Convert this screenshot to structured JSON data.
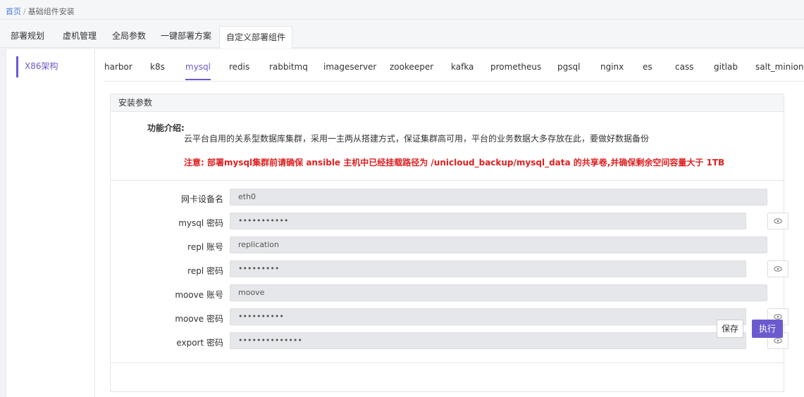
{
  "breadcrumb": {
    "home": "首页",
    "separator": "/",
    "current": "基础组件安装"
  },
  "top_tabs": [
    {
      "label": "部署规划",
      "active": false
    },
    {
      "label": "虚机管理",
      "active": false
    },
    {
      "label": "全局参数",
      "active": false
    },
    {
      "label": "一键部署方案",
      "active": false
    },
    {
      "label": "自定义部署组件",
      "active": true
    }
  ],
  "sidebar": {
    "items": [
      {
        "label": "X86架构",
        "active": true
      }
    ]
  },
  "sub_tabs": [
    {
      "label": "harbor"
    },
    {
      "label": "k8s"
    },
    {
      "label": "mysql",
      "active": true
    },
    {
      "label": "redis"
    },
    {
      "label": "rabbitmq"
    },
    {
      "label": "imageserver"
    },
    {
      "label": "zookeeper"
    },
    {
      "label": "kafka"
    },
    {
      "label": "prometheus"
    },
    {
      "label": "pgsql"
    },
    {
      "label": "nginx"
    },
    {
      "label": "es"
    },
    {
      "label": "cass"
    },
    {
      "label": "gitlab"
    },
    {
      "label": "salt_minion"
    }
  ],
  "panel": {
    "title": "安装参数",
    "intro_label": "功能介绍:",
    "intro_text": "云平台自用的关系型数据库集群，采用一主两从搭建方式，保证集群高可用，平台的业务数据大多存放在此，要做好数据备份",
    "warning": "注意: 部署mysql集群前请确保 ansible 主机中已经挂载路径为 /unicloud_backup/mysql_data 的共享卷,并确保剩余空间容量大于 1TB",
    "fields": [
      {
        "label": "网卡设备名",
        "value": "eth0",
        "password": false
      },
      {
        "label": "mysql 密码",
        "value": "•••••••••••",
        "password": true
      },
      {
        "label": "repl 账号",
        "value": "replication",
        "password": false
      },
      {
        "label": "repl 密码",
        "value": "•••••••••",
        "password": true
      },
      {
        "label": "moove 账号",
        "value": "moove",
        "password": false
      },
      {
        "label": "moove 密码",
        "value": "••••••••••",
        "password": true
      },
      {
        "label": "export 密码",
        "value": "••••••••••••••",
        "password": true
      }
    ]
  },
  "buttons": {
    "save": "保存",
    "execute": "执行"
  },
  "colors": {
    "accent": "#6a5acd",
    "warning": "#e02020",
    "link": "#4a7cd9"
  }
}
